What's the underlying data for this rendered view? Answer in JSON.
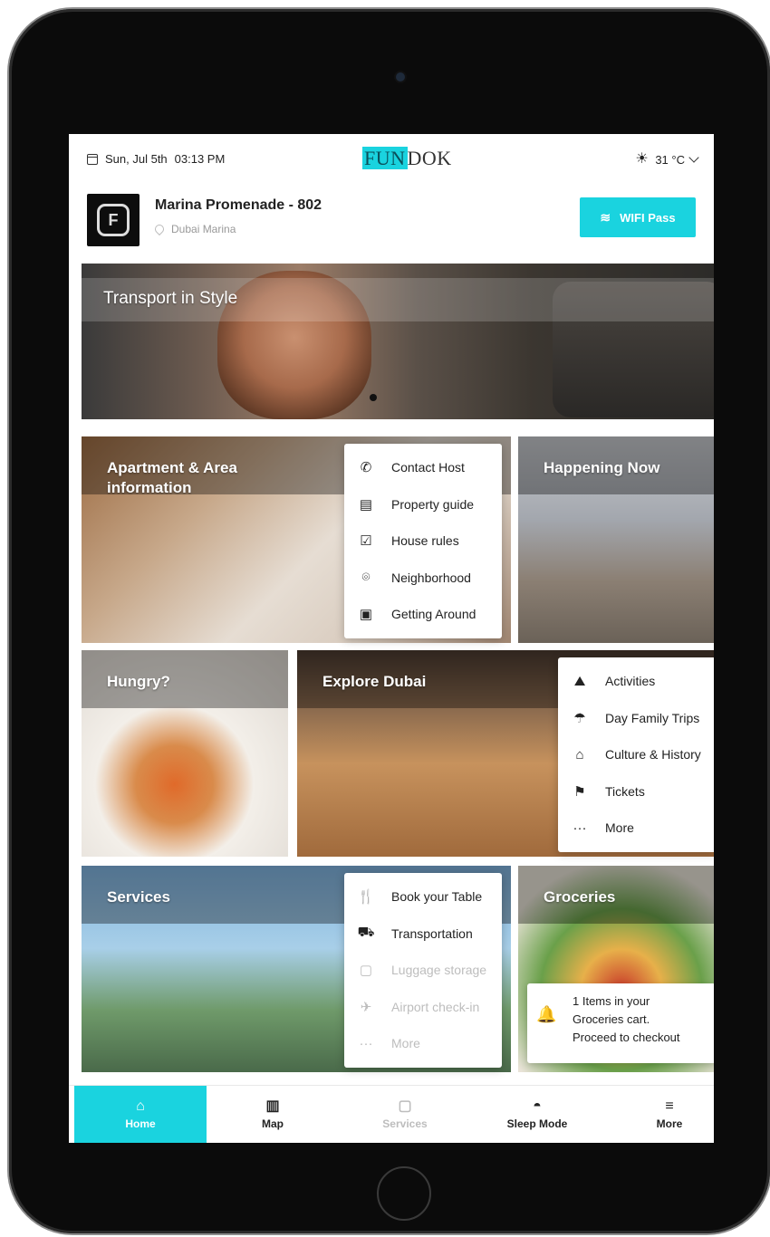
{
  "status": {
    "date": "Sun, Jul 5th",
    "time": "03:13 PM",
    "temperature": "31 °C"
  },
  "brand": {
    "logo_highlight": "FUN",
    "logo_rest": "DOK"
  },
  "property": {
    "name": "Marina Promenade - 802",
    "location": "Dubai Marina",
    "wifi_label": "WIFI Pass"
  },
  "tiles": {
    "transport": "Transport in Style",
    "apartment": "Apartment & Area information",
    "happening": "Happening Now",
    "hungry": "Hungry?",
    "explore": "Explore Dubai",
    "services": "Services",
    "groceries": "Groceries"
  },
  "apartment_menu": [
    {
      "label": "Contact Host",
      "icon": "phone-icon"
    },
    {
      "label": "Property guide",
      "icon": "book-icon"
    },
    {
      "label": "House rules",
      "icon": "checkbox-icon"
    },
    {
      "label": "Neighborhood",
      "icon": "location-pin-icon"
    },
    {
      "label": "Getting Around",
      "icon": "bus-icon"
    }
  ],
  "explore_menu": [
    {
      "label": "Activities",
      "icon": "mountain-icon"
    },
    {
      "label": "Day Family Trips",
      "icon": "beach-umbrella-icon"
    },
    {
      "label": "Culture & History",
      "icon": "museum-icon"
    },
    {
      "label": "Tickets",
      "icon": "flag-icon"
    },
    {
      "label": "More",
      "icon": "ellipsis-icon"
    }
  ],
  "services_menu": [
    {
      "label": "Book your Table",
      "icon": "restaurant-icon"
    },
    {
      "label": "Transportation",
      "icon": "car-icon"
    },
    {
      "label": "Luggage storage",
      "icon": "luggage-icon"
    },
    {
      "label": "Airport check-in",
      "icon": "airplane-icon"
    },
    {
      "label": "More",
      "icon": "ellipsis-icon"
    }
  ],
  "cart": {
    "line1": "1 Items in your",
    "line2": "Groceries cart.",
    "line3": "Proceed to checkout"
  },
  "nav": {
    "home": "Home",
    "map": "Map",
    "services": "Services",
    "sleep": "Sleep Mode",
    "more": "More"
  },
  "colors": {
    "accent": "#1ad3df",
    "alert": "#e23b3b"
  }
}
